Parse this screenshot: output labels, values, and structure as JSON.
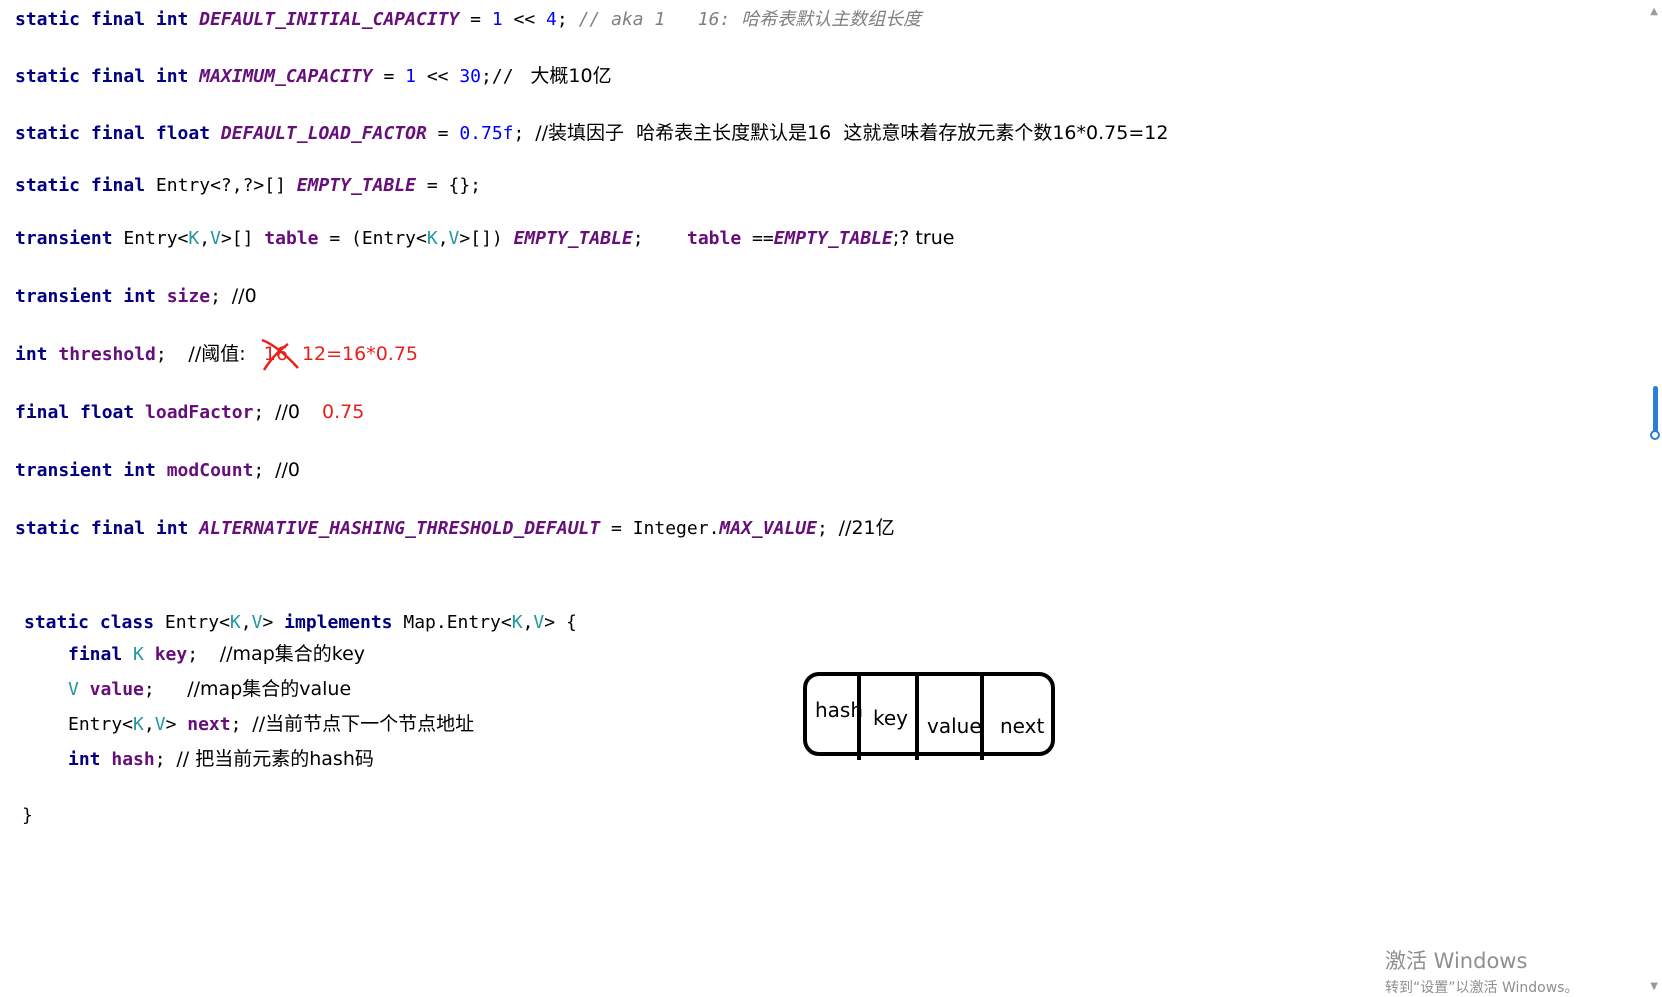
{
  "code": {
    "l1": {
      "p1": "static final int ",
      "c1": "DEFAULT_INITIAL_CAPACITY",
      "p2": " = ",
      "n1": "1",
      "p3": " << ",
      "n2": "4",
      "p4": "; ",
      "cm": "// aka 1   16: 哈希表默认主数组长度"
    },
    "l2": {
      "p1": "static final int ",
      "c1": "MAXIMUM_CAPACITY",
      "p2": " = ",
      "n1": "1",
      "p3": " << ",
      "n2": "30",
      "p4": ";// ",
      "zh": " 大概10亿"
    },
    "l3": {
      "p1": "static final float ",
      "c1": "DEFAULT_LOAD_FACTOR",
      "p2": " = ",
      "n1": "0.75f",
      "p3": "; ",
      "zh": "//装填因子  哈希表主长度默认是16  这就意味着存放元素个数16*0.75=12"
    },
    "l4": {
      "p1": "static final ",
      "p2": "Entry<?,?>[] ",
      "c1": "EMPTY_TABLE",
      "p3": " = {};"
    },
    "l5": {
      "p1": "transient ",
      "p2": "Entry<",
      "t1": "K",
      "p3": ",",
      "t2": "V",
      "p4": ">[] ",
      "f1": "table",
      "p5": " = (Entry<",
      "t3": "K",
      "p6": ",",
      "t4": "V",
      "p7": ">[]) ",
      "c1": "EMPTY_TABLE",
      "p8": ";    ",
      "f2": "table",
      "p9": " ==",
      "c2": "EMPTY_TABLE",
      "zh": ";? true"
    },
    "l6": {
      "p1": "transient int ",
      "f1": "size",
      "p2": "; ",
      "zh": "//0"
    },
    "l7": {
      "p1": "int ",
      "f1": "threshold",
      "p2": ";  ",
      "zh": "//阈值:   ",
      "struck": "16",
      "red": "12=16*0.75"
    },
    "l8": {
      "p1": "final float ",
      "f1": "loadFactor",
      "p2": "; ",
      "zh": "//0",
      "red": "0.75"
    },
    "l9": {
      "p1": "transient int ",
      "f1": "modCount",
      "p2": "; ",
      "zh": "//0"
    },
    "l10": {
      "p1": "static final int ",
      "c1": "ALTERNATIVE_HASHING_THRESHOLD_DEFAULT",
      "p2": " = Integer.",
      "c2": "MAX_VALUE",
      "p3": "; ",
      "zh": "//21亿"
    },
    "l11": {
      "p1": "static class ",
      "p2": "Entry<",
      "t1": "K",
      "p3": ",",
      "t2": "V",
      "p4": "> ",
      "k2": "implements",
      "p5": " Map.Entry<",
      "t3": "K",
      "p6": ",",
      "t4": "V",
      "p7": "> {"
    },
    "l12": {
      "p1": "final ",
      "t1": "K",
      "f1": " key",
      "p2": ";  ",
      "zh": "//map集合的key"
    },
    "l13": {
      "t1": "V",
      "f1": " value",
      "p2": ";   ",
      "zh": "//map集合的value"
    },
    "l14": {
      "p1": "Entry<",
      "t1": "K",
      "p2": ",",
      "t2": "V",
      "p3": "> ",
      "f1": "next",
      "p4": "; ",
      "zh": "//当前节点下一个节点地址"
    },
    "l15": {
      "p1": "int ",
      "f1": "hash",
      "p2": "; ",
      "zh": "// 把当前元素的hash码"
    },
    "l16": {
      "p1": "}"
    }
  },
  "diagram": {
    "cells": [
      "hash",
      "key",
      "value",
      "next"
    ]
  },
  "watermark": {
    "title": "激活 Windows",
    "subtitle": "转到“设置”以激活 Windows。"
  },
  "colors": {
    "keyword": "#000080",
    "constant": "#660e7a",
    "number": "#0000ff",
    "type_param": "#20999d",
    "comment": "#808080",
    "annotation_red": "#e8201c",
    "scrollbar": "#2b7ddb"
  }
}
